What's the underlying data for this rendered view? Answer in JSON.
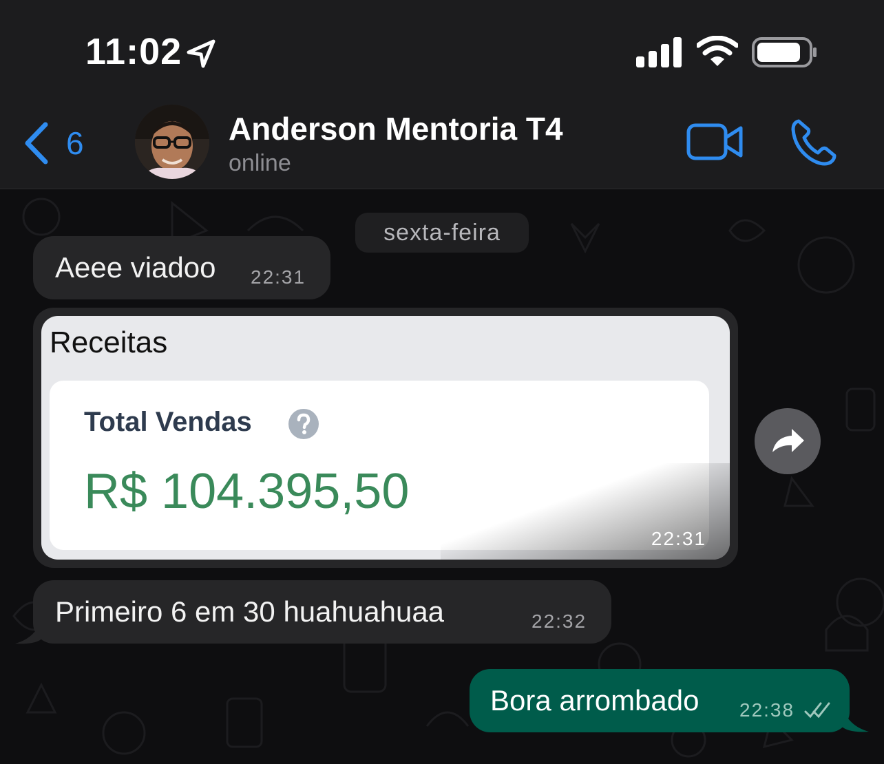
{
  "status_bar": {
    "time": "11:02"
  },
  "header": {
    "back_count": "6",
    "contact_name": "Anderson Mentoria T4",
    "contact_status": "online"
  },
  "chat": {
    "date_label": "sexta-feira",
    "messages": [
      {
        "direction": "incoming",
        "text": "Aeee viadoo",
        "time": "22:31"
      },
      {
        "direction": "incoming",
        "type": "image",
        "image": {
          "title": "Receitas",
          "card_label": "Total Vendas",
          "card_value": "R$ 104.395,50"
        },
        "time": "22:31"
      },
      {
        "direction": "incoming",
        "text": "Primeiro 6 em 30 huahuahuaa",
        "time": "22:32"
      },
      {
        "direction": "outgoing",
        "text": "Bora arrombado",
        "time": "22:38",
        "status": "read"
      }
    ]
  },
  "colors": {
    "accent": "#2f8cf0",
    "incoming_bubble": "#262628",
    "outgoing_bubble": "#005c4b",
    "value_green": "#3a8a5a"
  }
}
